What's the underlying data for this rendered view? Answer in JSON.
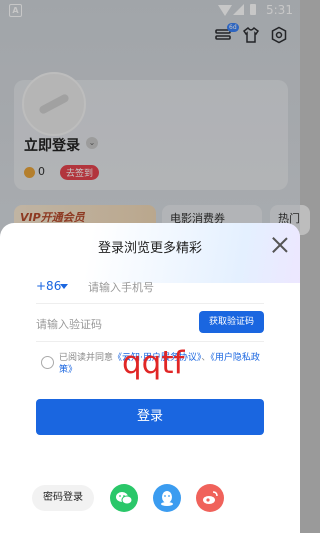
{
  "status_bar": {
    "time": "5:31",
    "left_icon": "A"
  },
  "top_icons": {
    "badge": "6d",
    "icons": [
      "hanger-stack-icon",
      "shirt-icon",
      "hexagon-settings-icon"
    ]
  },
  "profile": {
    "title": "立即登录",
    "coins": "0",
    "checkin": "去签到"
  },
  "tiles": {
    "vip": "VIP开通会员",
    "movie": "电影消费券",
    "hot": "热门"
  },
  "sheet": {
    "title": "登录浏览更多精彩",
    "country_code": "+86",
    "phone_placeholder": "请输入手机号",
    "code_placeholder": "请输入验证码",
    "get_code": "获取验证码",
    "agree_prefix": "已阅读并同意",
    "agree_link1": "《云知·用户服务协议》",
    "agree_sep": "、",
    "agree_link2": "《用户隐私政策》",
    "watermark": "qqtf",
    "login": "登录",
    "password_login": "密码登录"
  },
  "social_icons": [
    "wechat-icon",
    "qq-icon",
    "weibo-icon"
  ],
  "colors": {
    "primary": "#1a66e0",
    "wechat": "#2ac769",
    "qq": "#3b9cf0",
    "weibo": "#f0625b",
    "checkin": "#e5454f"
  }
}
